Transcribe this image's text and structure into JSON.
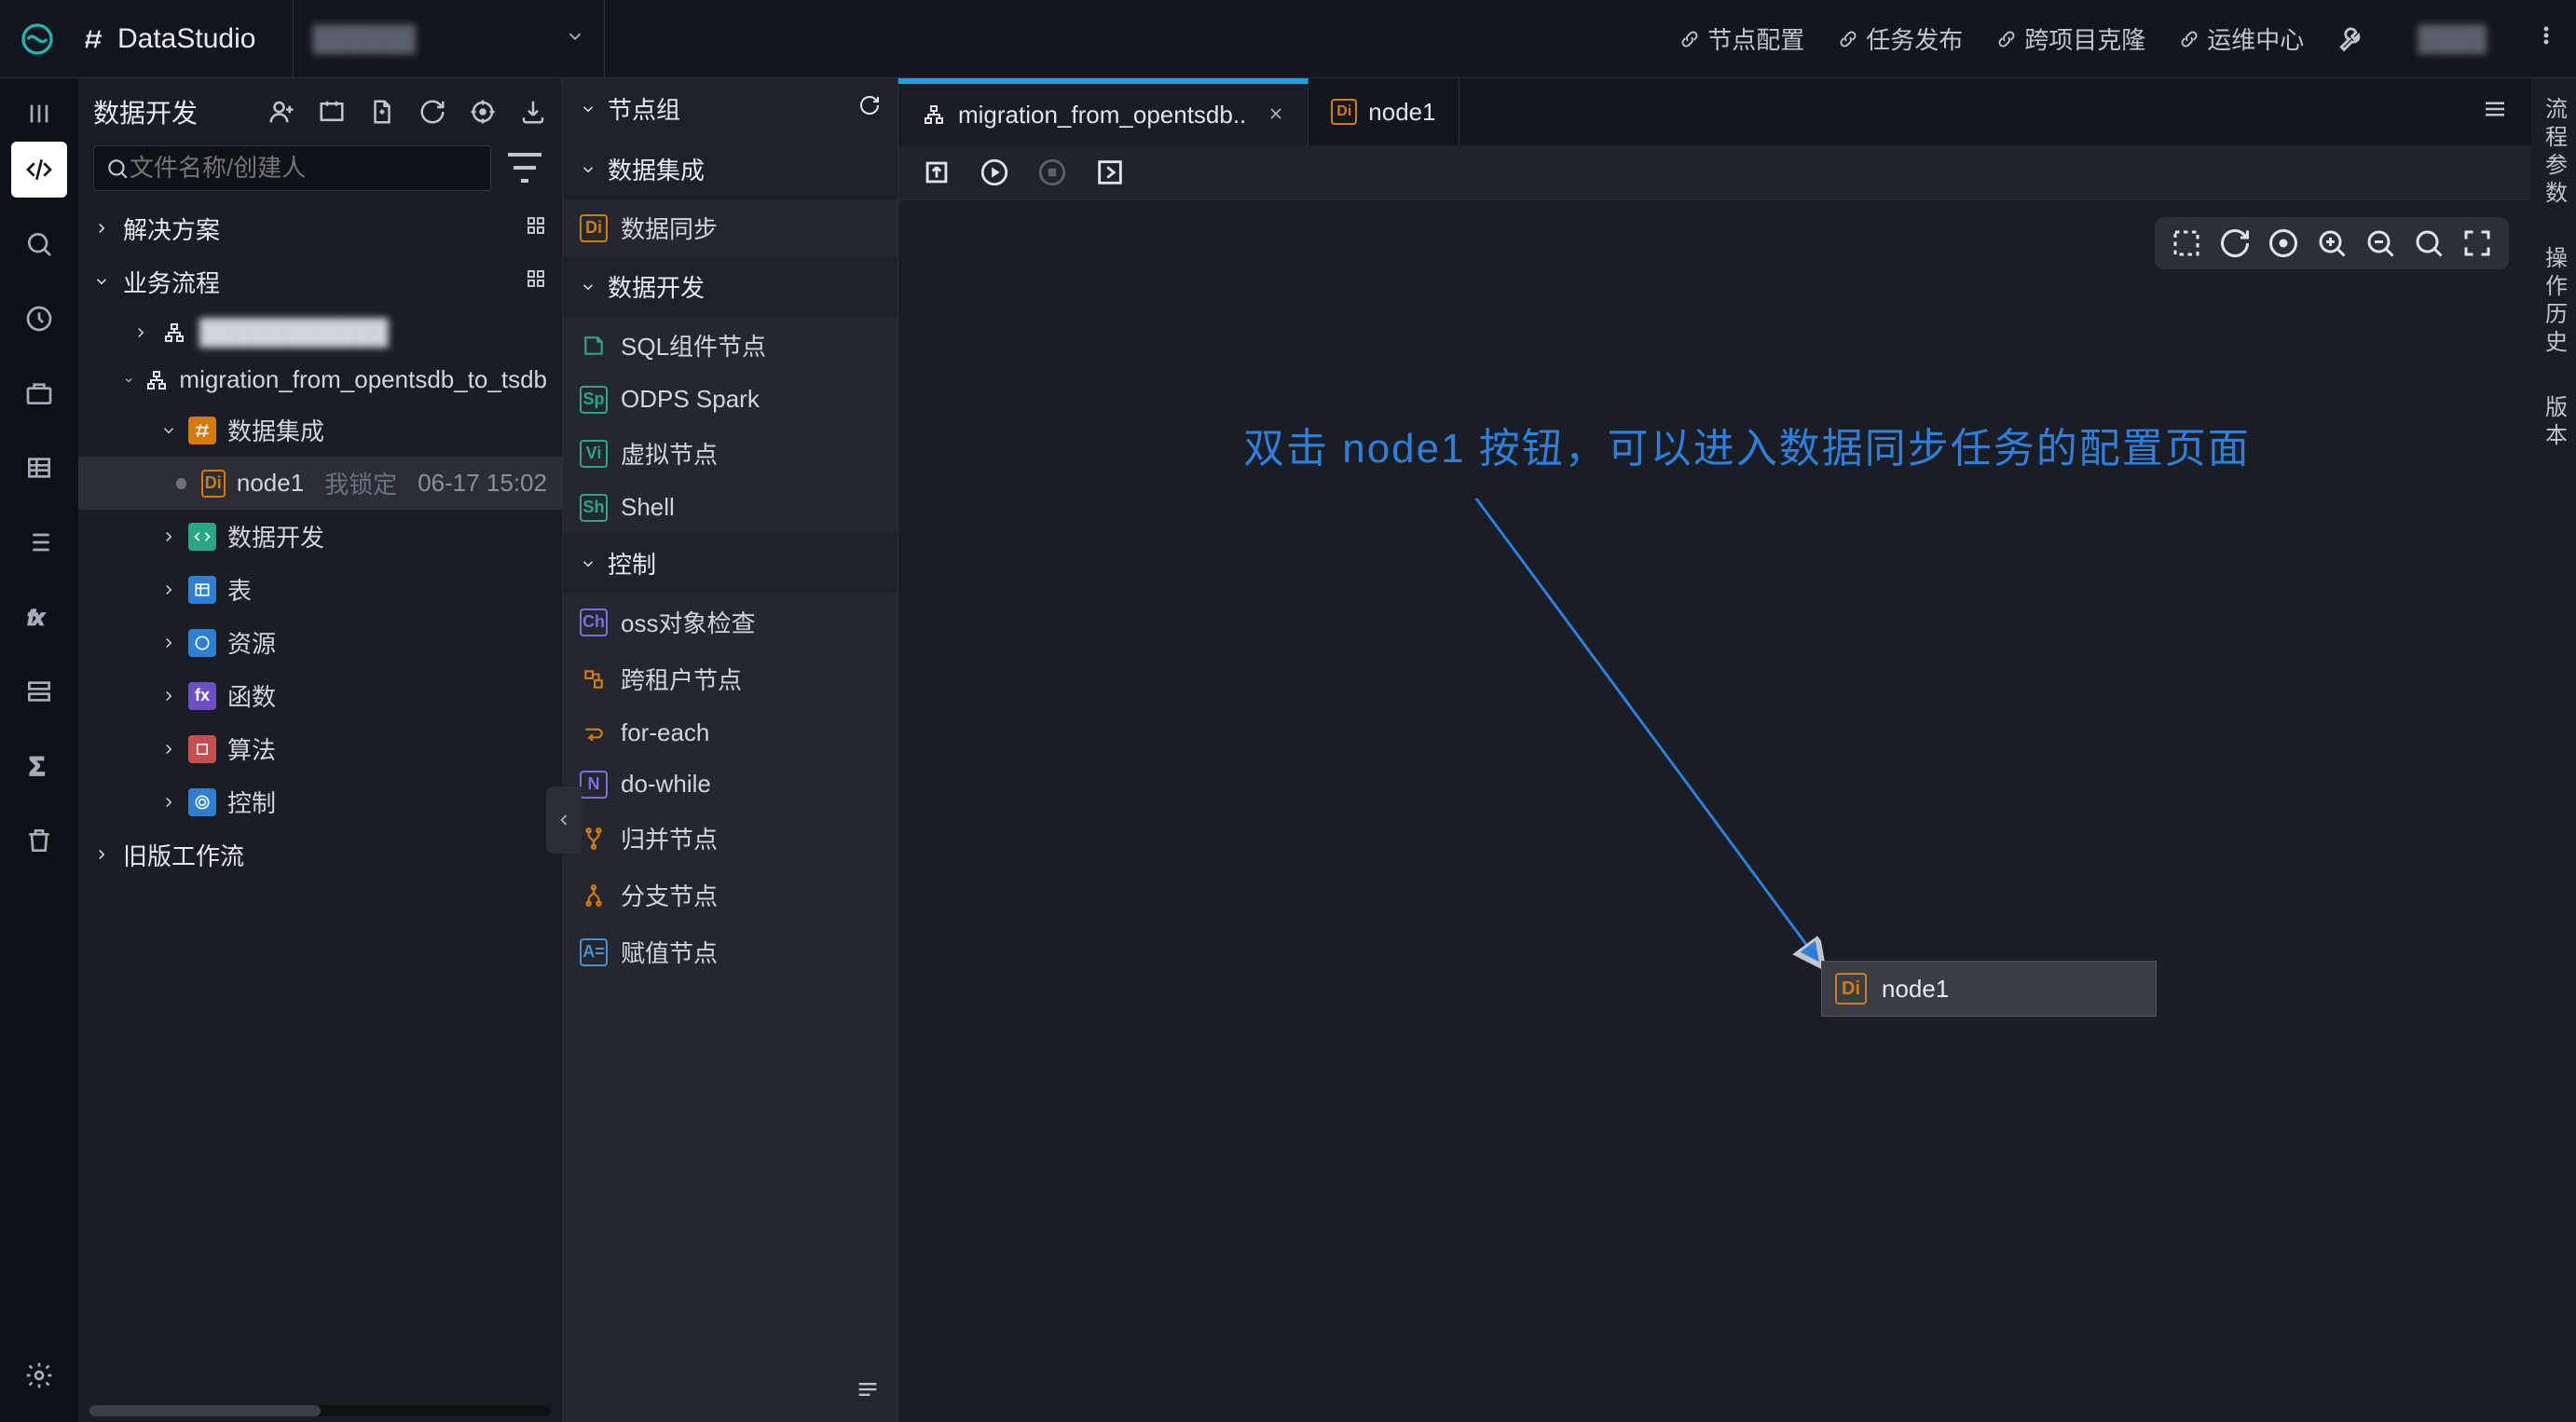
{
  "title": {
    "app": "DataStudio",
    "project": "██████"
  },
  "header_links": [
    {
      "label": "节点配置"
    },
    {
      "label": "任务发布"
    },
    {
      "label": "跨项目克隆"
    },
    {
      "label": "运维中心"
    }
  ],
  "header_user": "████",
  "file_panel": {
    "title": "数据开发",
    "search_placeholder": "文件名称/创建人",
    "sections": {
      "solutions": "解决方案",
      "flows": "业务流程",
      "legacy": "旧版工作流"
    },
    "flow_items": {
      "blurred": "███████████",
      "migration": "migration_from_opentsdb_to_tsdb",
      "integration": "数据集成",
      "node1": "node1",
      "lock": "我锁定",
      "lock_time": "06-17 15:02",
      "datadev": "数据开发",
      "table": "表",
      "resource": "资源",
      "func": "函数",
      "algo": "算法",
      "control": "控制"
    }
  },
  "palette": {
    "group": "节点组",
    "integration": "数据集成",
    "sync": "数据同步",
    "datadev": "数据开发",
    "sql": "SQL组件节点",
    "spark": "ODPS Spark",
    "virtual": "虚拟节点",
    "shell": "Shell",
    "control": "控制",
    "oss": "oss对象检查",
    "cross": "跨租户节点",
    "foreach": "for-each",
    "dowhile": "do-while",
    "merge": "归并节点",
    "branch": "分支节点",
    "assign": "赋值节点"
  },
  "tabs": {
    "active": "migration_from_opentsdb..",
    "second": "node1"
  },
  "annotation": "双击 node1 按钮，可以进入数据同步任务的配置页面",
  "canvas_node": {
    "label": "node1",
    "badge": "Di"
  },
  "right_rail": {
    "params": "流程参数",
    "history": "操作历史",
    "version": "版本"
  }
}
